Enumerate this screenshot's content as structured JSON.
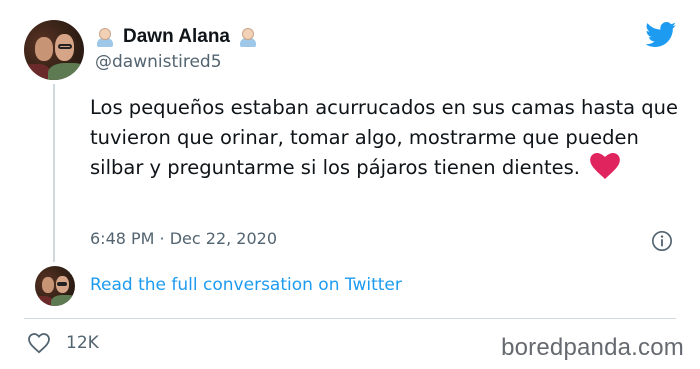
{
  "author": {
    "display_name": "Dawn Alana",
    "handle": "@dawnistired5",
    "name_emoji": "person-emoji-icon"
  },
  "tweet": {
    "text": "Los pequeños estaban acurrucados en sus camas hasta que tuvieron que orinar, tomar algo, mostrarme que pueden silbar y preguntarme si los pájaros tienen dientes.",
    "emoji": "red-heart-icon",
    "timestamp": "6:48 PM · Dec 22, 2020"
  },
  "conversation_link": "Read the full conversation on Twitter",
  "stats": {
    "likes": "12K"
  },
  "watermark": "boredpanda.com",
  "colors": {
    "twitter_blue": "#1d9bf0",
    "heart_red": "#e0245e",
    "secondary_text": "#536471",
    "divider": "#cfd9de"
  }
}
